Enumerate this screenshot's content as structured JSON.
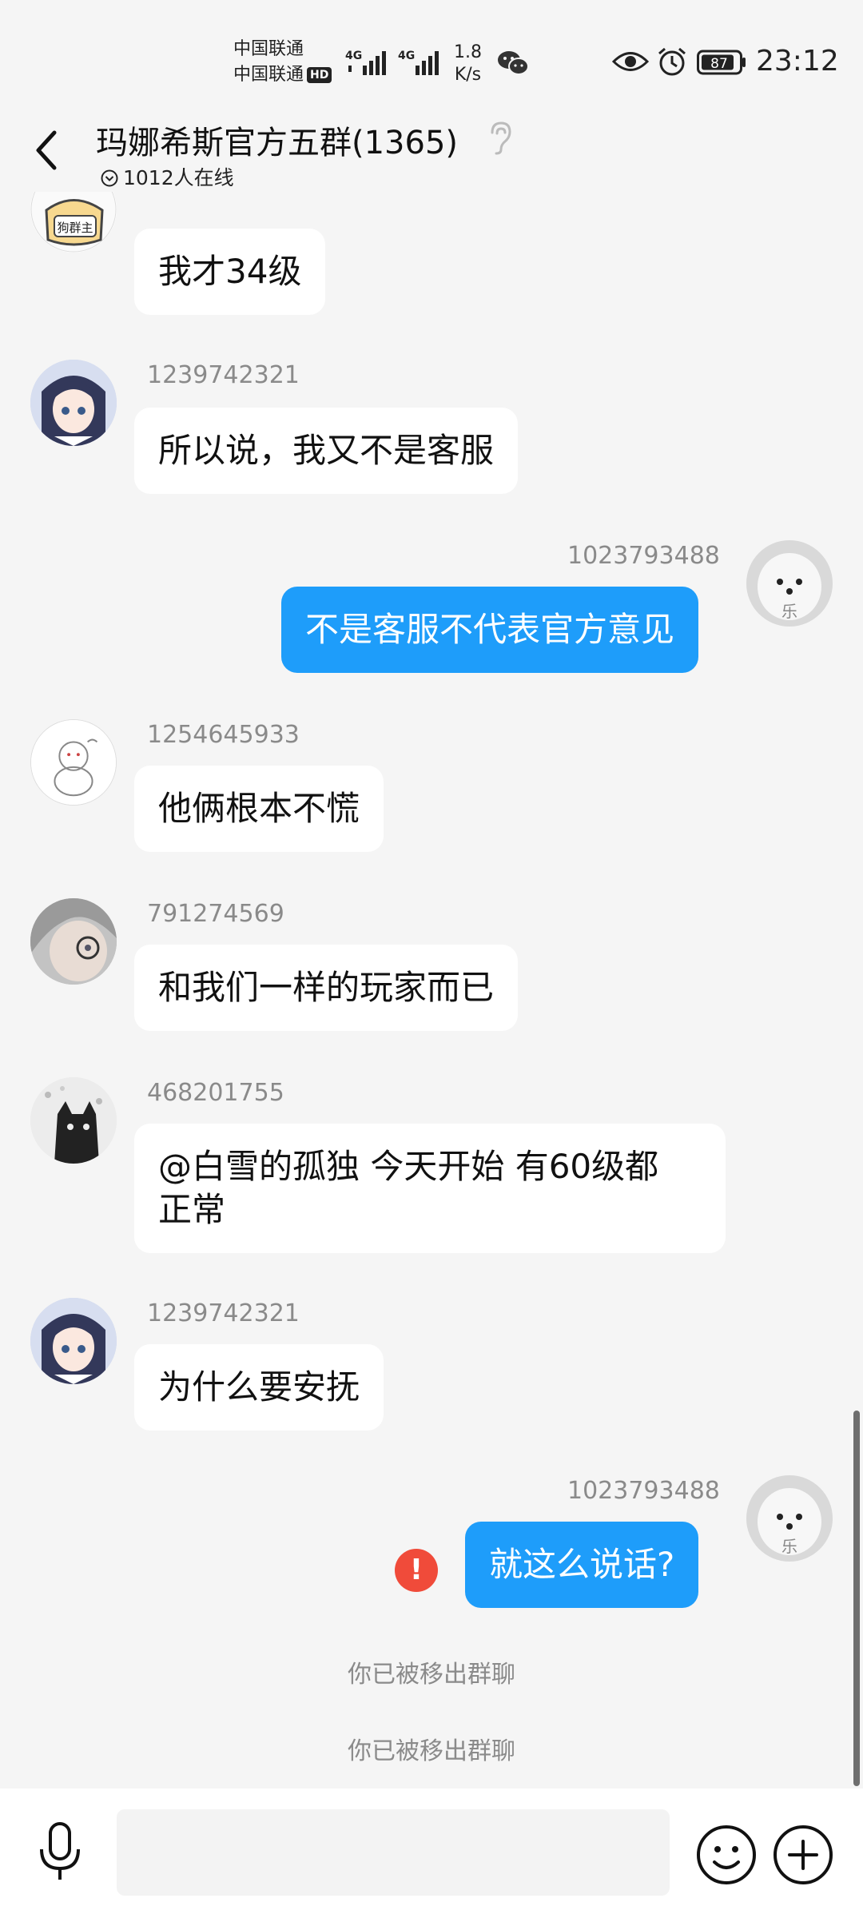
{
  "status_bar": {
    "carrier1": "中国联通",
    "carrier2": "中国联通",
    "hd_badge": "HD",
    "net_type1": "4G",
    "net_type2": "4G",
    "net_speed_value": "1.8",
    "net_speed_unit": "K/s",
    "battery": "87",
    "time": "23:12"
  },
  "header": {
    "title": "玛娜希斯官方五群(1365)",
    "online": "1012人在线"
  },
  "messages": [
    {
      "sender": "",
      "text": "我才34级",
      "avatar": "group-owner-avatar",
      "avatar_badge": "狗群主"
    },
    {
      "sender": "1239742321",
      "text": "所以说，我又不是客服"
    },
    {
      "sender": "1023793488",
      "text": "不是客服不代表官方意见",
      "avatar_badge": "乐"
    },
    {
      "sender": "1254645933",
      "text": "他俩根本不慌"
    },
    {
      "sender": "791274569",
      "text": "和我们一样的玩家而已"
    },
    {
      "sender": "468201755",
      "text_line1": "@白雪的孤独 今天开始 有60级都",
      "text_line2": "正常"
    },
    {
      "sender": "1239742321",
      "text": "为什么要安抚"
    },
    {
      "sender": "1023793488",
      "text": "就这么说话?",
      "avatar_badge": "乐"
    }
  ],
  "notices": [
    "你已被移出群聊",
    "你已被移出群聊"
  ],
  "error_mark": "!",
  "colors": {
    "background": "#f5f5f5",
    "outgoing_bubble": "#1e9dfa",
    "incoming_bubble": "#ffffff",
    "error": "#f04b3a",
    "meta_text": "#8a8a8a"
  }
}
